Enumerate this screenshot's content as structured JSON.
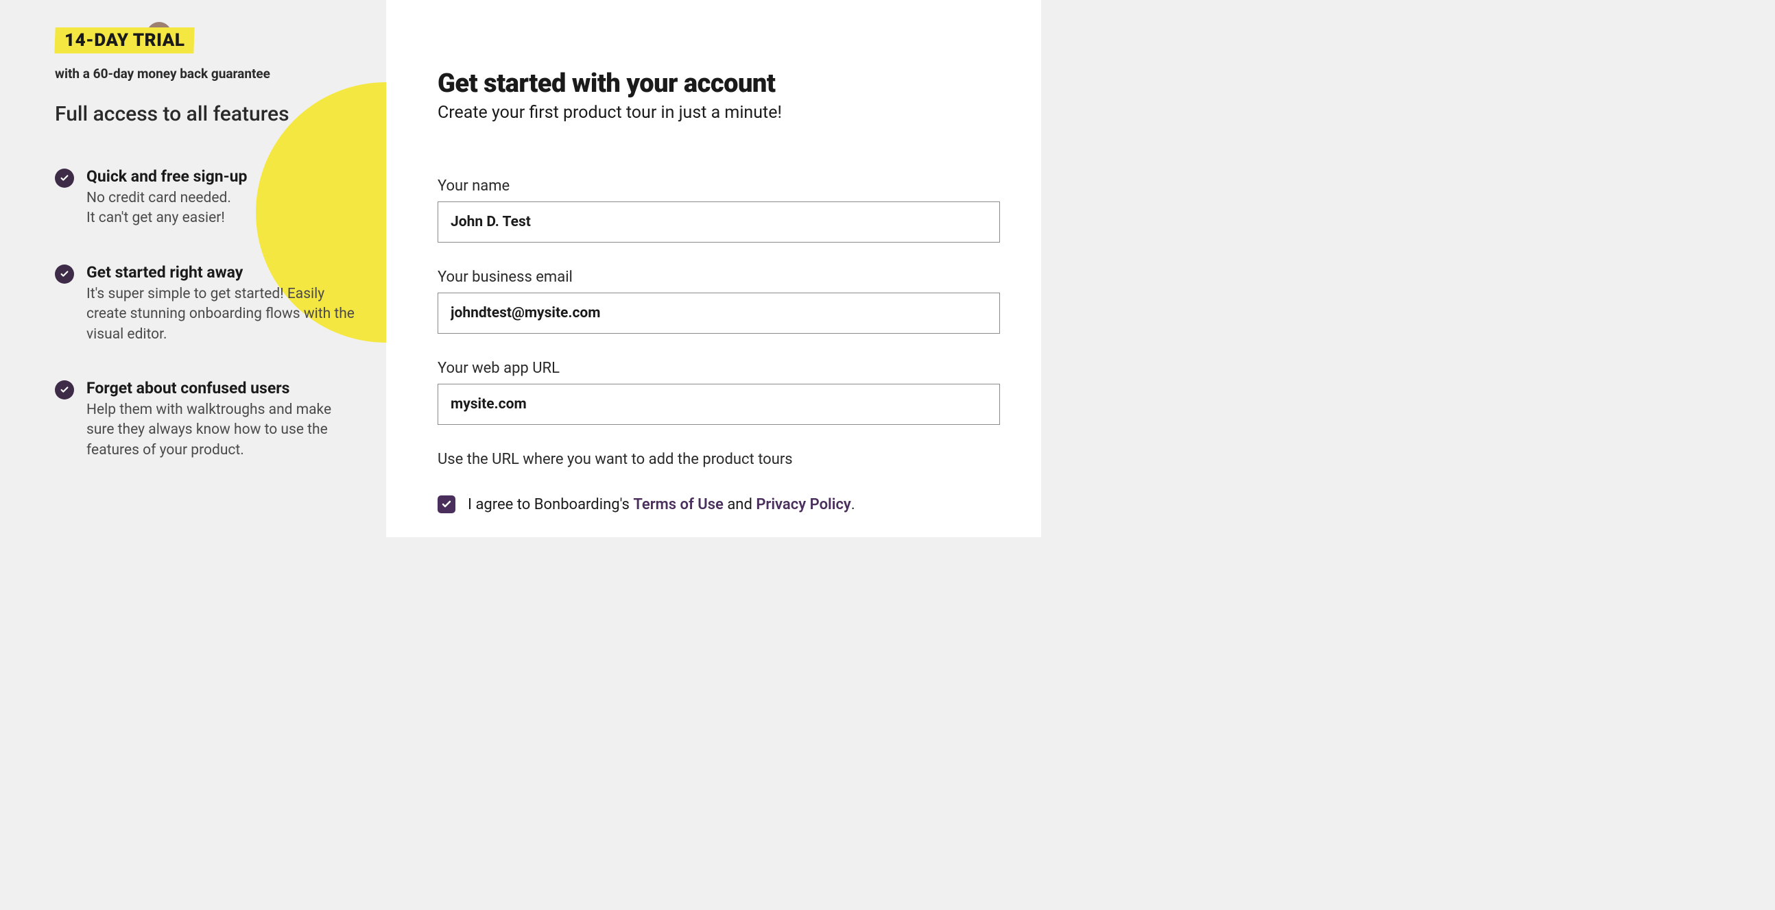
{
  "left": {
    "trial_badge": "14-DAY TRIAL",
    "guarantee": "with a 60-day money back guarantee",
    "features_title": "Full access to all features",
    "features": [
      {
        "title": "Quick and free sign-up",
        "desc": "No credit card needed.\nIt can't get any easier!"
      },
      {
        "title": "Get started right away",
        "desc": "It's super simple to get started! Easily create stunning onboarding flows with the visual editor."
      },
      {
        "title": "Forget about confused users",
        "desc": "Help them with walktroughs and make sure they always know how to use the features of your product."
      }
    ]
  },
  "form": {
    "title": "Get started with your account",
    "subtitle": "Create your first product tour in just a minute!",
    "name_label": "Your name",
    "name_value": "John D. Test",
    "email_label": "Your business email",
    "email_value": "johndtest@mysite.com",
    "url_label": "Your web app URL",
    "url_value": "mysite.com",
    "url_hint": "Use the URL where you want to add the product tours",
    "agree_prefix": "I agree to Bonboarding's ",
    "terms_link": "Terms of Use",
    "agree_mid": " and ",
    "privacy_link": "Privacy Policy",
    "agree_suffix": "."
  },
  "colors": {
    "accent_yellow": "#f5e742",
    "dark_purple": "#3e2b47",
    "link_purple": "#4a2f5c"
  }
}
